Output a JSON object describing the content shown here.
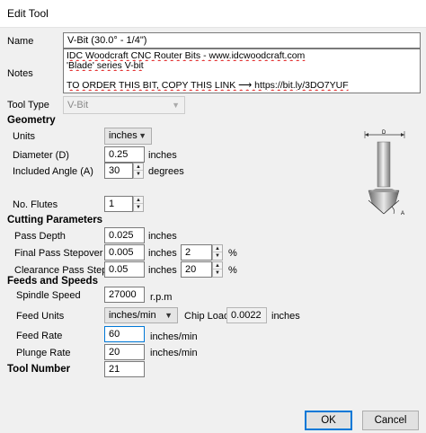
{
  "window": {
    "title": "Edit Tool"
  },
  "name": {
    "label": "Name",
    "value": "V-Bit (30.0° - 1/4\")"
  },
  "notes": {
    "label": "Notes",
    "lines": [
      "IDC Woodcraft CNC Router Bits - www.idcwoodcraft.com",
      "'Blade' series V-bit",
      "",
      "TO ORDER THIS BIT, COPY THIS LINK ⟶ https://bit.ly/3DO7YUF"
    ]
  },
  "tool_type": {
    "label": "Tool Type",
    "value": "V-Bit"
  },
  "geometry": {
    "heading": "Geometry",
    "units": {
      "label": "Units",
      "value": "inches"
    },
    "diameter": {
      "label": "Diameter (D)",
      "value": "0.25",
      "unit": "inches"
    },
    "angle": {
      "label": "Included Angle (A)",
      "value": "30",
      "unit": "degrees"
    },
    "flutes": {
      "label": "No. Flutes",
      "value": "1"
    }
  },
  "diagram": {
    "d_label": "D",
    "a_label": "A"
  },
  "cutting": {
    "heading": "Cutting Parameters",
    "pass_depth": {
      "label": "Pass Depth",
      "value": "0.025",
      "unit": "inches"
    },
    "final_stepover": {
      "label": "Final Pass Stepover",
      "value": "0.005",
      "unit": "inches",
      "percent": "2",
      "percent_unit": "%"
    },
    "clearance_stepover": {
      "label": "Clearance Pass Stepover",
      "value": "0.05",
      "unit": "inches",
      "percent": "20",
      "percent_unit": "%"
    }
  },
  "feeds": {
    "heading": "Feeds and Speeds",
    "spindle": {
      "label": "Spindle Speed",
      "value": "27000",
      "unit": "r.p.m"
    },
    "feed_units": {
      "label": "Feed Units",
      "value": "inches/min"
    },
    "chip_load": {
      "label": "Chip Load",
      "value": "0.0022",
      "unit": "inches"
    },
    "feed_rate": {
      "label": "Feed Rate",
      "value": "60",
      "unit": "inches/min"
    },
    "plunge_rate": {
      "label": "Plunge Rate",
      "value": "20",
      "unit": "inches/min"
    }
  },
  "tool_number": {
    "label": "Tool Number",
    "value": "21"
  },
  "buttons": {
    "ok": "OK",
    "cancel": "Cancel"
  },
  "colors": {
    "accent": "#0078d7",
    "dialog_bg": "#f0f0f0"
  }
}
